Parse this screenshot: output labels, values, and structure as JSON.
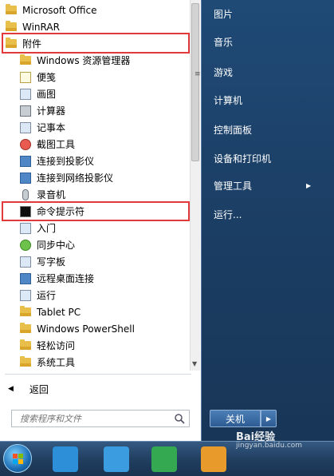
{
  "programs": {
    "items": [
      {
        "label": "Microsoft Office",
        "icon": "folder-icon",
        "level": 0
      },
      {
        "label": "WinRAR",
        "icon": "folder-icon",
        "level": 0
      },
      {
        "label": "附件",
        "icon": "folder-icon",
        "level": 0
      },
      {
        "label": "Windows 资源管理器",
        "icon": "explorer-icon",
        "level": 1
      },
      {
        "label": "便笺",
        "icon": "sticky-note-icon",
        "level": 1
      },
      {
        "label": "画图",
        "icon": "paint-icon",
        "level": 1
      },
      {
        "label": "计算器",
        "icon": "calculator-icon",
        "level": 1
      },
      {
        "label": "记事本",
        "icon": "notepad-icon",
        "level": 1
      },
      {
        "label": "截图工具",
        "icon": "snipping-tool-icon",
        "level": 1
      },
      {
        "label": "连接到投影仪",
        "icon": "projector-icon",
        "level": 1
      },
      {
        "label": "连接到网络投影仪",
        "icon": "network-projector-icon",
        "level": 1
      },
      {
        "label": "录音机",
        "icon": "microphone-icon",
        "level": 1
      },
      {
        "label": "命令提示符",
        "icon": "command-prompt-icon",
        "level": 1
      },
      {
        "label": "入门",
        "icon": "getting-started-icon",
        "level": 1
      },
      {
        "label": "同步中心",
        "icon": "sync-center-icon",
        "level": 1
      },
      {
        "label": "写字板",
        "icon": "wordpad-icon",
        "level": 1
      },
      {
        "label": "远程桌面连接",
        "icon": "remote-desktop-icon",
        "level": 1
      },
      {
        "label": "运行",
        "icon": "run-icon",
        "level": 1
      },
      {
        "label": "Tablet PC",
        "icon": "folder-icon",
        "level": 1
      },
      {
        "label": "Windows PowerShell",
        "icon": "folder-icon",
        "level": 1
      },
      {
        "label": "轻松访问",
        "icon": "folder-icon",
        "level": 1
      },
      {
        "label": "系统工具",
        "icon": "folder-icon",
        "level": 1
      }
    ]
  },
  "back_label": "返回",
  "search": {
    "placeholder": "搜索程序和文件"
  },
  "right_panel": {
    "items": [
      {
        "label": "图片"
      },
      {
        "label": "音乐"
      },
      {
        "label": "游戏"
      },
      {
        "label": "计算机"
      },
      {
        "label": "控制面板"
      },
      {
        "label": "设备和打印机"
      },
      {
        "label": "管理工具"
      },
      {
        "label": "运行..."
      }
    ],
    "shutdown_label": "关机"
  },
  "watermark": {
    "text": "Bai经验",
    "sub": "jingyan.baidu.com"
  },
  "colors": {
    "highlight": "#e23a3a",
    "panel_blue": "#1f4a76",
    "accent": "#2d5c93"
  }
}
